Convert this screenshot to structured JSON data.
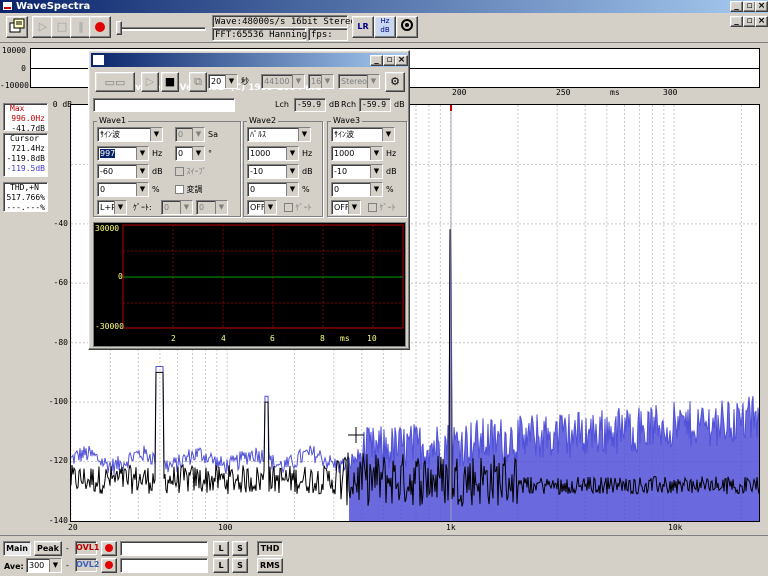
{
  "app": {
    "title": "WaveSpectra",
    "window_buttons": [
      "_",
      "▫",
      "×"
    ],
    "menu_buttons": [
      "_",
      "▫",
      "×"
    ]
  },
  "toolbar": {
    "wave_info": "Wave:48000s/s 16bit Stereo",
    "fft_info": "FFT:65536 Hanning",
    "fps_label": "fps:",
    "lr_label": "LR",
    "hzdb_label": "Hz dB"
  },
  "time_strip": {
    "y_max": "10000",
    "y_mid": "0",
    "y_min": "-10000"
  },
  "left_panel": {
    "max_label": "Max",
    "max_freq": "996.0Hz",
    "max_level": "-41.7dB",
    "cursor_label": "Cursor",
    "cursor_freq": "721.4Hz",
    "cursor_level": "-119.8dB",
    "cursor_level2": "-119.5dB",
    "thd_label": "THD,+N",
    "thd_value": "517.766%",
    "thd_value2": "---.---%"
  },
  "spectrum": {
    "db_top": "0 dB",
    "y_ticks": [
      "-40",
      "-60",
      "-80",
      "-100",
      "-120",
      "-140"
    ],
    "x_ticks": [
      "20",
      "100",
      "1k",
      "10k"
    ],
    "time_ticks": [
      "200",
      "250",
      "300"
    ],
    "time_unit": "ms",
    "colors": {
      "left": "#000000",
      "right": "#5050d8",
      "grid": "#c0c0c0",
      "marker": "#a0a0c0"
    }
  },
  "wavegene": {
    "title": "WaveGene  Ver. 1.31  (C) 1999-2004 efu",
    "seconds_value": "20",
    "seconds_unit": "秒",
    "samplerate": "44100",
    "bits": "16",
    "channels": "Stereo",
    "lch_label": "Lch",
    "lch_value": "-59.9",
    "rch_label": "Rch",
    "rch_value": "-59.9",
    "db_unit": "dB",
    "wave1": {
      "label": "Wave1",
      "type": "ｻｲﾝ波",
      "sa_value": "0",
      "sa_unit": "Sa",
      "freq": "997",
      "freq_unit": "Hz",
      "phase": "0",
      "phase_unit": "°",
      "level": "-60",
      "level_unit": "dB",
      "sweep_label": "ｽｲｰﾌﾟ",
      "offset": "0",
      "pct_unit": "%",
      "mod_label": "変調",
      "channel": "L+R",
      "gate_label": "ｹﾞｰﾄ:",
      "gate1": "0",
      "gate2": "0"
    },
    "wave2": {
      "label": "Wave2",
      "type": "ﾊﾟﾙｽ",
      "freq": "1000",
      "freq_unit": "Hz",
      "level": "-10",
      "level_unit": "dB",
      "offset": "0",
      "pct_unit": "%",
      "channel": "OFF",
      "gate_label": "ｹﾞｰﾄ"
    },
    "wave3": {
      "label": "Wave3",
      "type": "ｻｲﾝ波",
      "freq": "1000",
      "freq_unit": "Hz",
      "level": "-10",
      "level_unit": "dB",
      "offset": "0",
      "pct_unit": "%",
      "channel": "OFF",
      "gate_label": "ｹﾞｰﾄ"
    },
    "plot": {
      "y_max": "30000",
      "y_mid": "0",
      "y_min": "-30000",
      "x_ticks": [
        "2",
        "4",
        "6",
        "8",
        "10"
      ],
      "x_unit": "ms"
    }
  },
  "bottom": {
    "main_label": "Main",
    "peak_label": "Peak",
    "dash": "-",
    "ovl1": "OVL1",
    "ovl2": "OVL2",
    "l_label": "L",
    "s_label": "S",
    "thd_button": "THD",
    "rms_button": "RMS",
    "ave_label": "Ave:",
    "ave_value": "300"
  }
}
